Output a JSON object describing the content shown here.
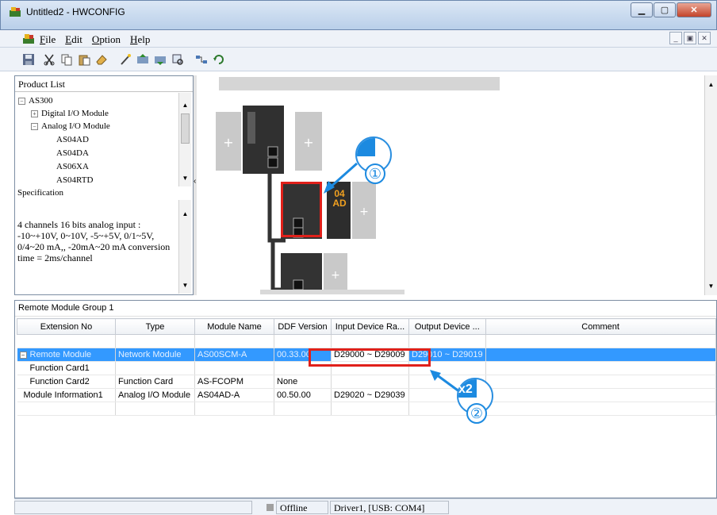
{
  "window": {
    "title": "Untitled2 - HWCONFIG"
  },
  "menu": [
    "File",
    "Edit",
    "Option",
    "Help"
  ],
  "product_list": {
    "header": "Product List",
    "tree": [
      {
        "label": "AS300",
        "level": 0,
        "expander": "−"
      },
      {
        "label": "Digital I/O Module",
        "level": 1,
        "expander": "+"
      },
      {
        "label": "Analog I/O Module",
        "level": 1,
        "expander": "−"
      },
      {
        "label": "AS04AD",
        "level": 2
      },
      {
        "label": "AS04DA",
        "level": 2
      },
      {
        "label": "AS06XA",
        "level": 2
      },
      {
        "label": "AS04RTD",
        "level": 2
      }
    ],
    "spec_header": "Specification",
    "spec_text": "4 channels 16 bits analog input : -10~+10V, 0~10V, -5~+5V, 0/1~5V, 0/4~20 mA,, -20mA~20 mA conversion time = 2ms/channel"
  },
  "canvas": {
    "module_label_line1": "04",
    "module_label_line2": "AD"
  },
  "grid": {
    "group_title": "Remote Module Group 1",
    "columns": [
      "Extension No",
      "Type",
      "Module Name",
      "DDF Version",
      "Input Device Ra...",
      "Output Device ...",
      "Comment"
    ],
    "rows": [
      [
        "",
        "",
        "",
        "",
        "",
        "",
        ""
      ],
      [
        "Remote Module",
        "Network Module",
        "AS00SCM-A",
        "00.33.00",
        "D29000 ~ D29009",
        "D29010 ~ D29019",
        ""
      ],
      [
        "Function Card1",
        "",
        "",
        "",
        "",
        "",
        ""
      ],
      [
        "Function Card2",
        "Function Card",
        "AS-FCOPM",
        "None",
        "",
        "",
        ""
      ],
      [
        "Module Information1",
        "Analog I/O Module",
        "AS04AD-A",
        "00.50.00",
        "D29020 ~ D29039",
        "",
        ""
      ],
      [
        "",
        "",
        "",
        "",
        "",
        "",
        ""
      ]
    ]
  },
  "status": {
    "mode": "Offline",
    "driver": "Driver1, [USB: COM4]"
  },
  "annotations": {
    "step1": "①",
    "step2": "②",
    "multiplier": "x2"
  },
  "colors": {
    "selection": "#3399ff",
    "highlight": "#e0201a",
    "callout": "#1c8ae0"
  }
}
